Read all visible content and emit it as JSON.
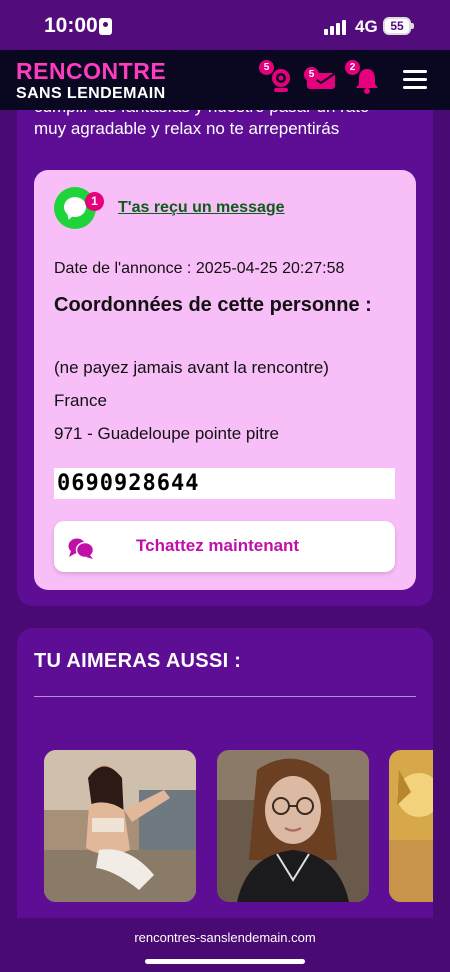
{
  "status_bar": {
    "time": "10:00",
    "network": "4G",
    "battery": "55"
  },
  "header": {
    "logo_line1": "RENCONTRE",
    "logo_line2": "SANS LENDEMAIN",
    "webcam_badge": "5",
    "messages_badge": "5",
    "notifications_badge": "2"
  },
  "listing": {
    "description_partial_line": "cumplir tus fantasías y nuestro pasar un rato",
    "description_line": "muy agradable y relax no te arrepentirás",
    "message_badge": "1",
    "message_link": "T'as reçu un message",
    "ad_date": "Date de l'annonce : 2025-04-25 20:27:58",
    "contact_title": "Coordonnées de cette personne :",
    "warning": "(ne payez jamais avant la rencontre)",
    "country": "France",
    "location": "971 - Guadeloupe pointe pitre",
    "phone": "0690928644",
    "chat_button": "Tchattez maintenant"
  },
  "suggestions": {
    "title": "TU AIMERAS AUSSI :"
  },
  "footer": {
    "url": "rencontres-sanslendemain.com"
  },
  "colors": {
    "background": "#4a0a73",
    "card": "#5e0e94",
    "info_box": "#f8bef8",
    "header": "#0a0720",
    "brand_pink": "#ff3cc0",
    "badge": "#e6007e",
    "chat_text": "#c010a8",
    "message_green": "#1fd33a",
    "link_green": "#0d5c1a"
  }
}
